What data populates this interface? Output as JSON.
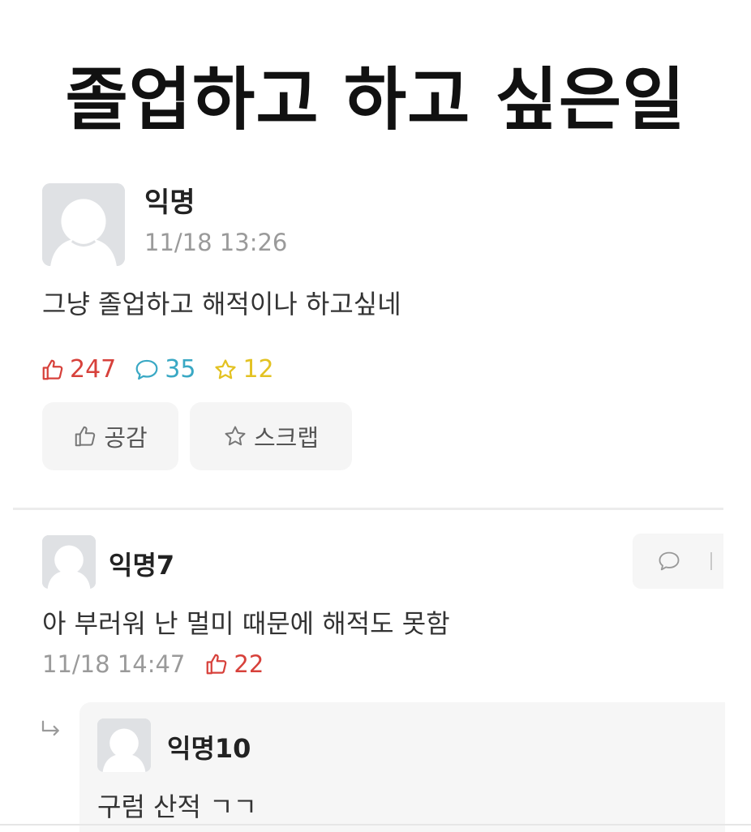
{
  "headline": "졸업하고 하고 싶은일",
  "post": {
    "author": "익명",
    "time": "11/18 13:26",
    "body": "그냥 졸업하고 해적이나 하고싶네",
    "likes": "247",
    "comments": "35",
    "scraps": "12",
    "like_button_label": "공감",
    "scrap_button_label": "스크랩"
  },
  "comment": {
    "author": "익명7",
    "body": "아 부러워 난 멀미 때문에 해적도 못함",
    "time": "11/18 14:47",
    "likes": "22"
  },
  "reply": {
    "author": "익명10",
    "body": "구럼 산적 ㄱㄱ"
  },
  "colors": {
    "like": "#d7413b",
    "comment": "#39a8c4",
    "scrap": "#e3c222",
    "meta_gray": "#9a9a9a"
  },
  "icons": [
    "thumbs-up-icon",
    "speech-bubble-icon",
    "star-icon",
    "reply-arrow-icon",
    "avatar-placeholder-icon"
  ]
}
